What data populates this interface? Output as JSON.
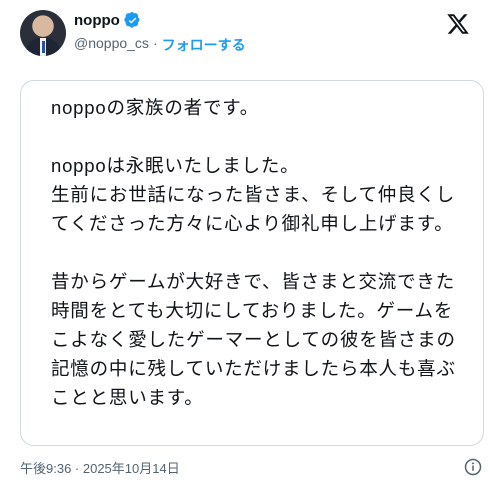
{
  "author": {
    "display_name": "noppo",
    "handle": "@noppo_cs",
    "separator": "·",
    "follow_label": "フォローする"
  },
  "post": {
    "lines": [
      "noppoの家族の者です。",
      "",
      "noppoは永眠いたしました。",
      "生前にお世話になった皆さま、そして仲良くし",
      "てくださった方々に心より御礼申し上げます。",
      "",
      "昔からゲームが大好きで、皆さまと交流できた",
      "時間をとても大切にしておりました。ゲームを",
      "こよなく愛したゲーマーとしての彼を皆さまの",
      "記憶の中に残していただけましたら本人も喜ぶ",
      "ことと思います。"
    ],
    "timestamp": "午後9:36 · 2025年10月14日"
  },
  "colors": {
    "accent": "#1d9bf0",
    "text": "#0f1419",
    "secondary": "#536471",
    "border": "#cfd9de"
  },
  "icons": {
    "verified": "verified-badge-icon",
    "logo": "x-logo-icon",
    "info": "info-icon"
  }
}
